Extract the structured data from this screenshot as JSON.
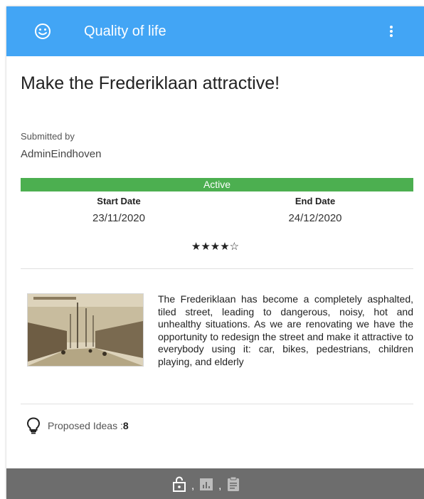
{
  "appbar": {
    "title": "Quality of life",
    "icons": [
      "smiley-icon",
      "more-vert-icon"
    ]
  },
  "proposal": {
    "title": "Make the Frederiklaan attractive!",
    "submitted_by_label": "Submitted by",
    "submitted_by": "AdminEindhoven",
    "status": "Active",
    "status_color": "#4caf50",
    "start_date_label": "Start Date",
    "start_date": "23/11/2020",
    "end_date_label": "End Date",
    "end_date": "24/12/2020",
    "rating_stars": "★★★★☆",
    "rating_value": 4,
    "rating_max": 5,
    "description": "The Frederiklaan has become a completely asphalted, tiled street, leading to dangerous, noisy, hot and unhealthy situations. As we are renovating we have the opportunity to redesign the street and make it attractive to everybody using it: car, bikes, pedestrians, children playing, and elderly",
    "image": "historic-street-photo",
    "ideas_label": "Proposed Ideas : ",
    "ideas_count": "8"
  },
  "footer": {
    "separator": ",",
    "steps": [
      "unlock-icon",
      "bar-chart-icon",
      "clipboard-icon"
    ]
  },
  "colors": {
    "appbar": "#42a5f5",
    "footer": "#6d6d6d"
  }
}
